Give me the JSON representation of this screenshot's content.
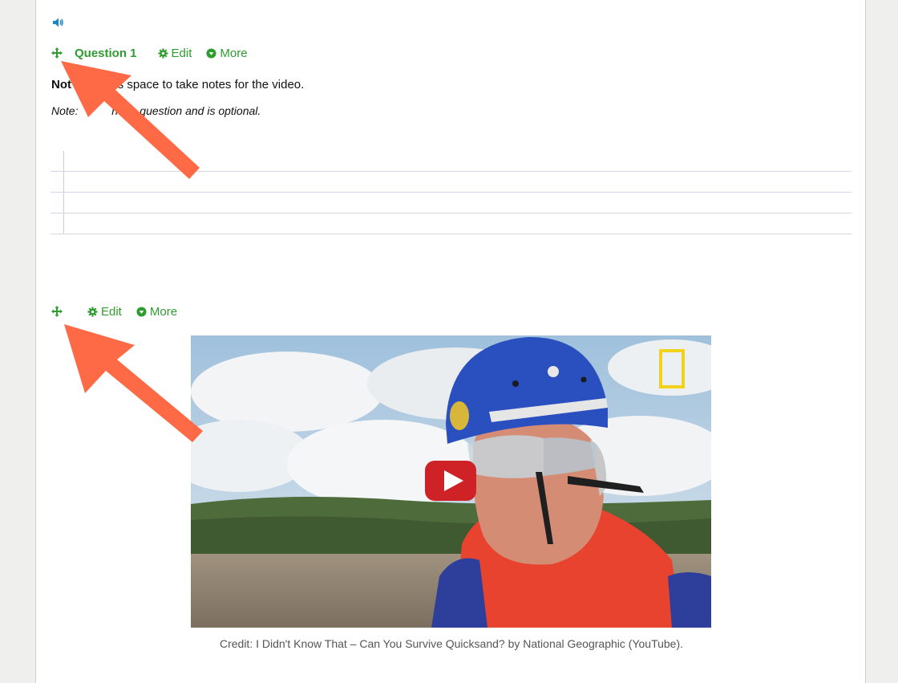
{
  "block1": {
    "question_title": "Question 1",
    "edit_label": "Edit",
    "more_label": "More",
    "notes_bold": "Not",
    "notes_text": "is space to take notes for the video.",
    "note_italic_prefix": "Note:",
    "note_italic_text": "not a question and is optional."
  },
  "block2": {
    "edit_label": "Edit",
    "more_label": "More"
  },
  "video": {
    "credit": "Credit: I Didn't Know That – Can You Survive Quicksand? by National Geographic (YouTube)."
  },
  "colors": {
    "accent_green": "#2f9c2f",
    "speaker_blue": "#1a86c7",
    "arrow_orange": "#ff6a46",
    "play_red": "#cf2227"
  },
  "icons": [
    "speaker-icon",
    "move-icon",
    "gear-icon",
    "chevron-down-circle-icon",
    "play-icon",
    "pointer-arrow"
  ]
}
